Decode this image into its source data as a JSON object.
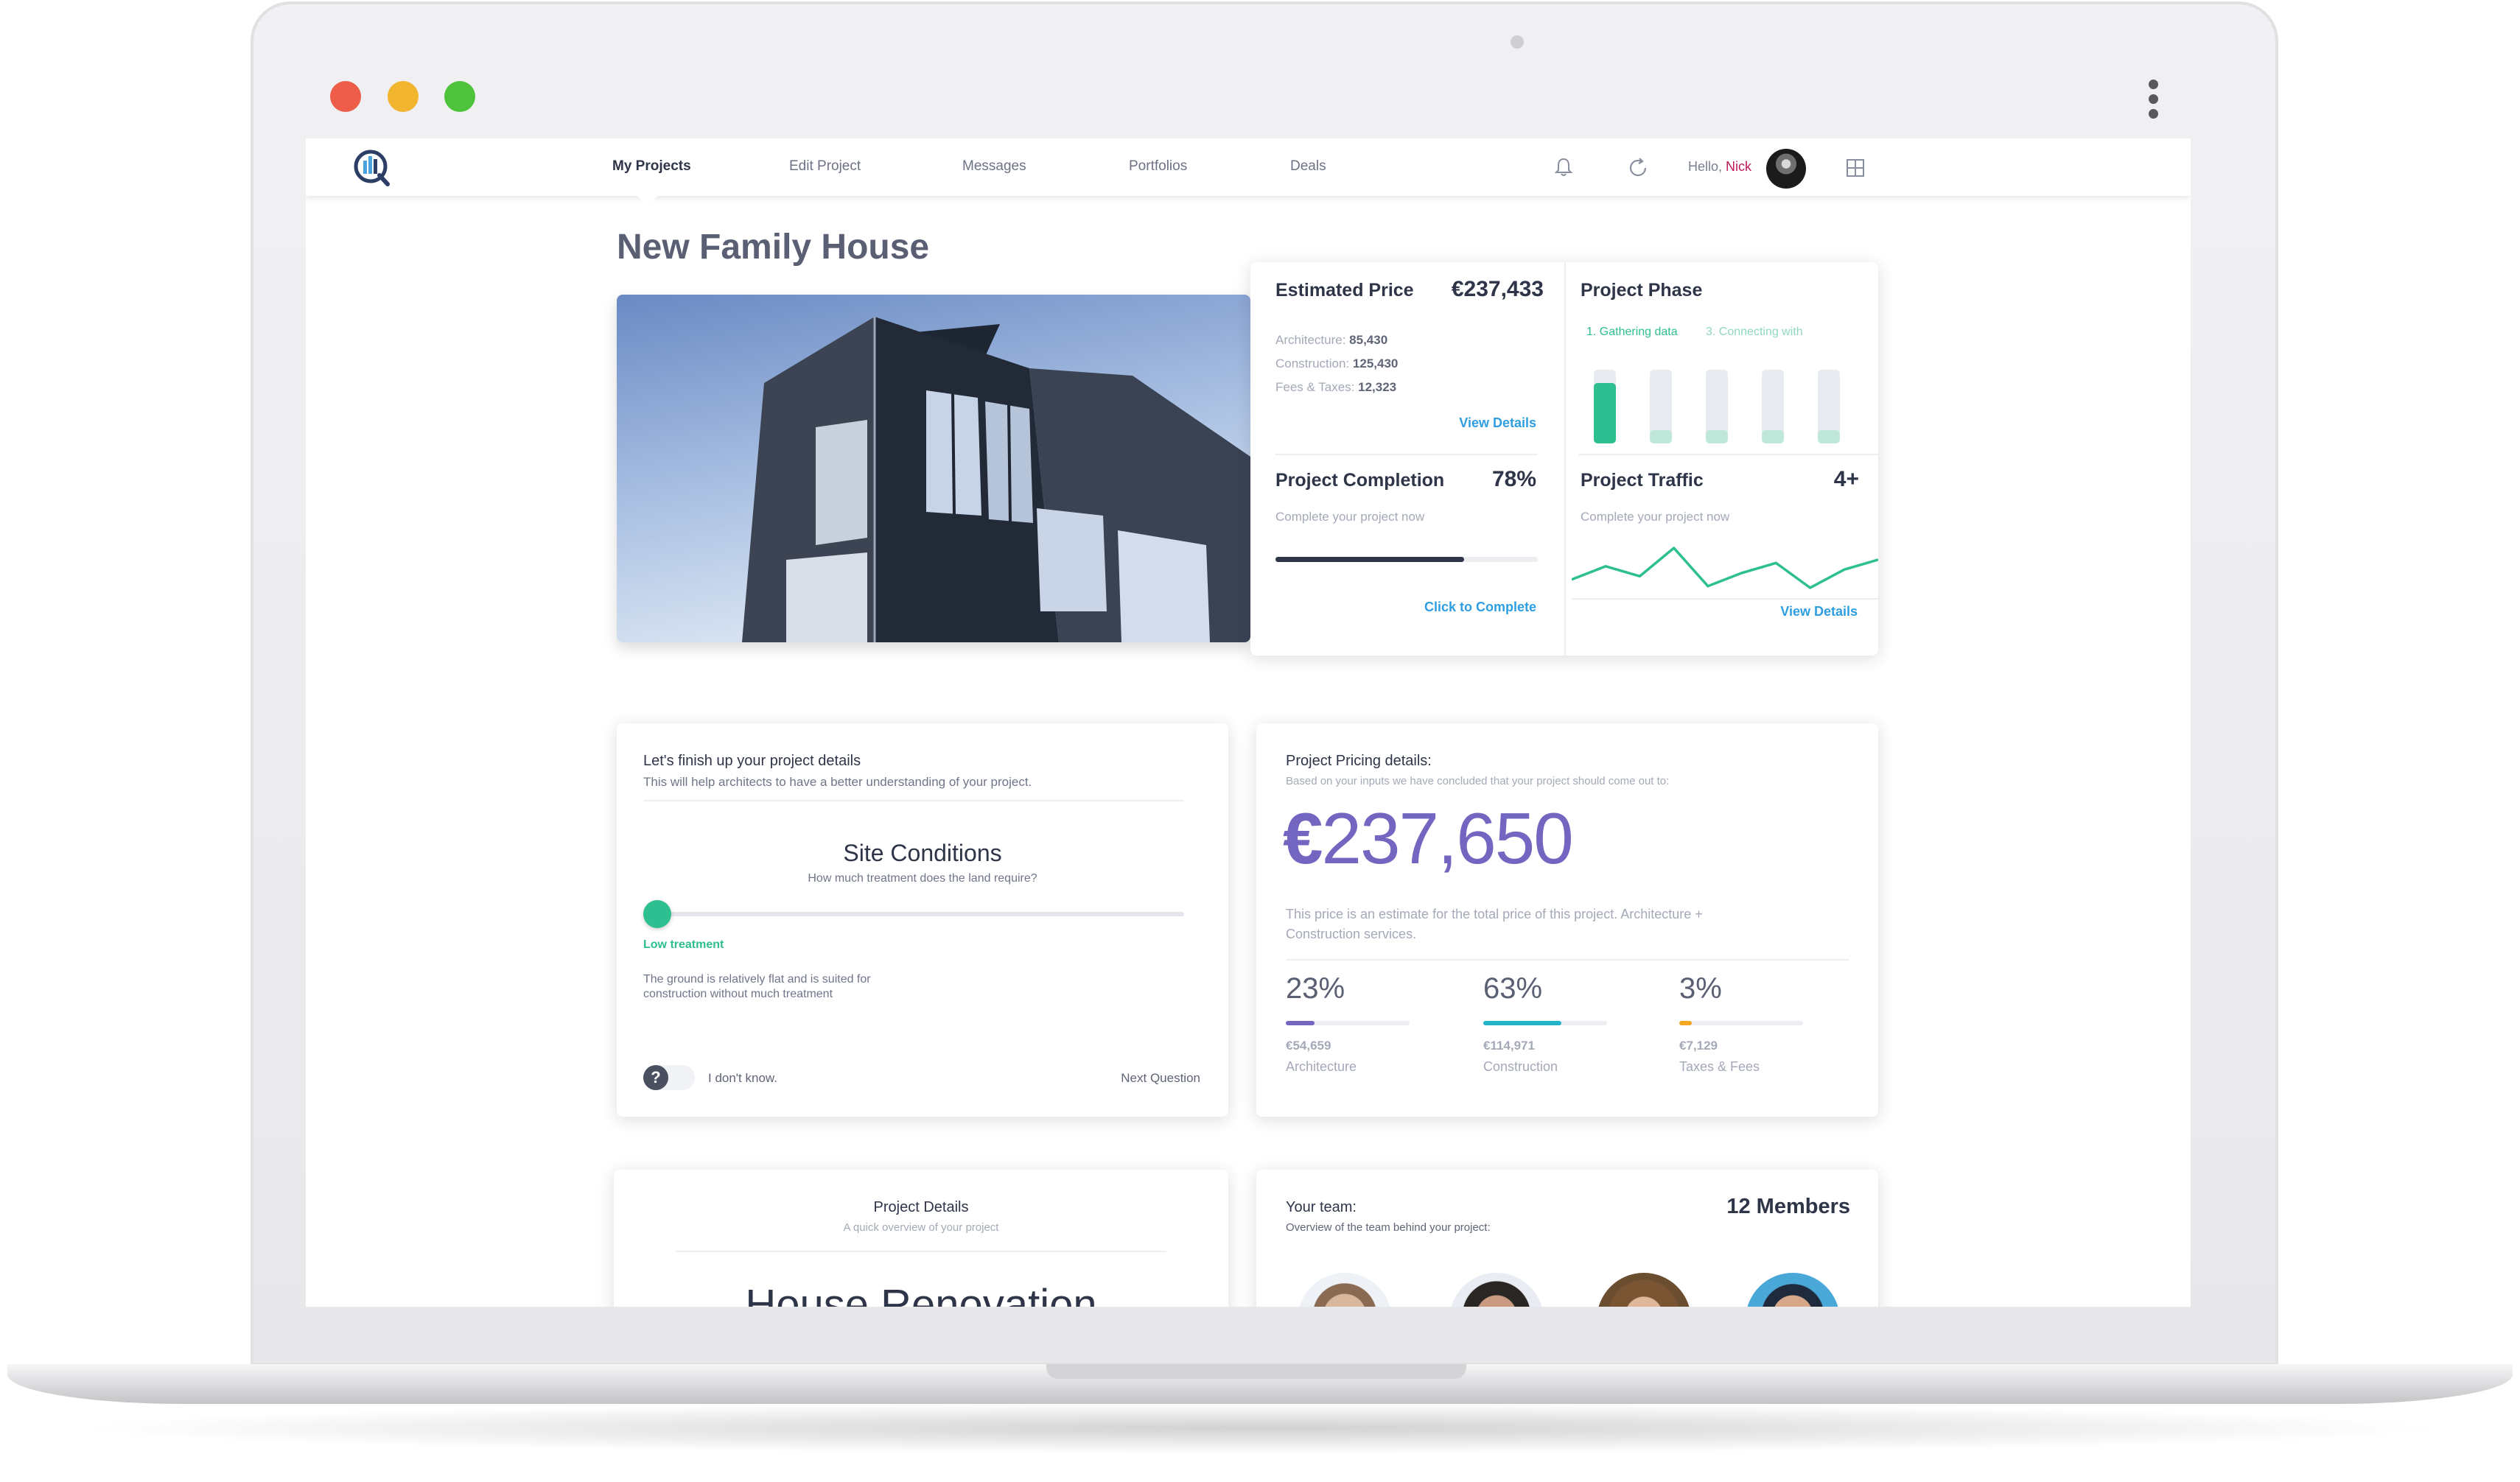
{
  "nav": {
    "items": [
      {
        "label": "My Projects",
        "active": true
      },
      {
        "label": "Edit Project",
        "active": false
      },
      {
        "label": "Messages",
        "active": false
      },
      {
        "label": "Portfolios",
        "active": false
      },
      {
        "label": "Deals",
        "active": false
      }
    ],
    "greeting": "Hello,",
    "user_name": "Nick"
  },
  "project": {
    "title": "New Family House"
  },
  "estimated_price": {
    "title": "Estimated Price",
    "value": "€237,433",
    "lines": [
      {
        "label": "Architecture:",
        "value": "85,430"
      },
      {
        "label": "Construction:",
        "value": "125,430"
      },
      {
        "label": "Fees & Taxes:",
        "value": "12,323"
      }
    ],
    "link": "View Details"
  },
  "project_phase": {
    "title": "Project Phase",
    "current": "1. Gathering data",
    "next": "3. Connecting with",
    "bars": [
      {
        "fill": 0.82,
        "state": "active"
      },
      {
        "fill": 0.18,
        "state": "pending"
      },
      {
        "fill": 0.18,
        "state": "pending"
      },
      {
        "fill": 0.18,
        "state": "pending"
      },
      {
        "fill": 0.18,
        "state": "pending"
      }
    ],
    "colors": {
      "active": "#2dbf8f",
      "pending": "#bfe8da",
      "text_active": "#2dbf8f",
      "text_next": "#8fd8bf"
    }
  },
  "completion": {
    "title": "Project Completion",
    "value": "78%",
    "progress": 0.72,
    "subtitle": "Complete your project now",
    "link": "Click to Complete"
  },
  "traffic": {
    "title": "Project Traffic",
    "value": "4+",
    "subtitle": "Complete your project now",
    "series": [
      22,
      30,
      24,
      41,
      18,
      26,
      32,
      17,
      28,
      34
    ],
    "color": "#2dbf8f",
    "link": "View Details"
  },
  "questionnaire": {
    "title": "Let's finish up your project details",
    "subtitle": "This will help architects to have a better understanding of your project.",
    "question": "Site Conditions",
    "question_sub": "How much treatment does the land require?",
    "slider_value": 0.0,
    "value_label": "Low treatment",
    "description": "The ground is relatively flat and is suited for construction without much treatment",
    "dont_know": "I don't know.",
    "next": "Next Question",
    "help_icon": "question-mark-icon"
  },
  "pricing": {
    "title": "Project Pricing details:",
    "subtitle": "Based on your inputs we have concluded that your project should come out to:",
    "currency": "€",
    "amount": "237,650",
    "note": "This price is an estimate for the total price of this project. Architecture + Construction services.",
    "breakdown": [
      {
        "percent": "23%",
        "fill": 0.23,
        "amount": "€54,659",
        "label": "Architecture",
        "color": "#7266c1"
      },
      {
        "percent": "63%",
        "fill": 0.63,
        "amount": "€114,971",
        "label": "Construction",
        "color": "#22b5c9"
      },
      {
        "percent": "3%",
        "fill": 0.1,
        "amount": "€7,129",
        "label": "Taxes & Fees",
        "color": "#f5a623"
      }
    ]
  },
  "details": {
    "title": "Project Details",
    "subtitle": "A quick overview of your project",
    "name": "House Renovation"
  },
  "team": {
    "title": "Your team:",
    "count": "12 Members",
    "subtitle": "Overview of the team behind your project:"
  },
  "icons": {
    "logo": "app-logo-icon",
    "bell": "bell-icon",
    "refresh": "refresh-icon",
    "grid": "grid-icon"
  }
}
